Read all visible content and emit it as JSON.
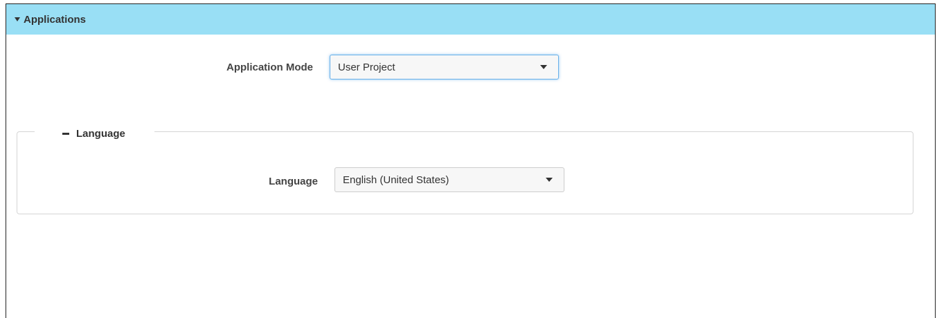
{
  "section": {
    "title": "Applications"
  },
  "application_mode": {
    "label": "Application Mode",
    "selected": "User Project"
  },
  "language_group": {
    "legend": "Language",
    "field_label": "Language",
    "selected": "English (United States)"
  },
  "colors": {
    "header_bg": "#99dff5",
    "focus_border": "#66afe9"
  }
}
